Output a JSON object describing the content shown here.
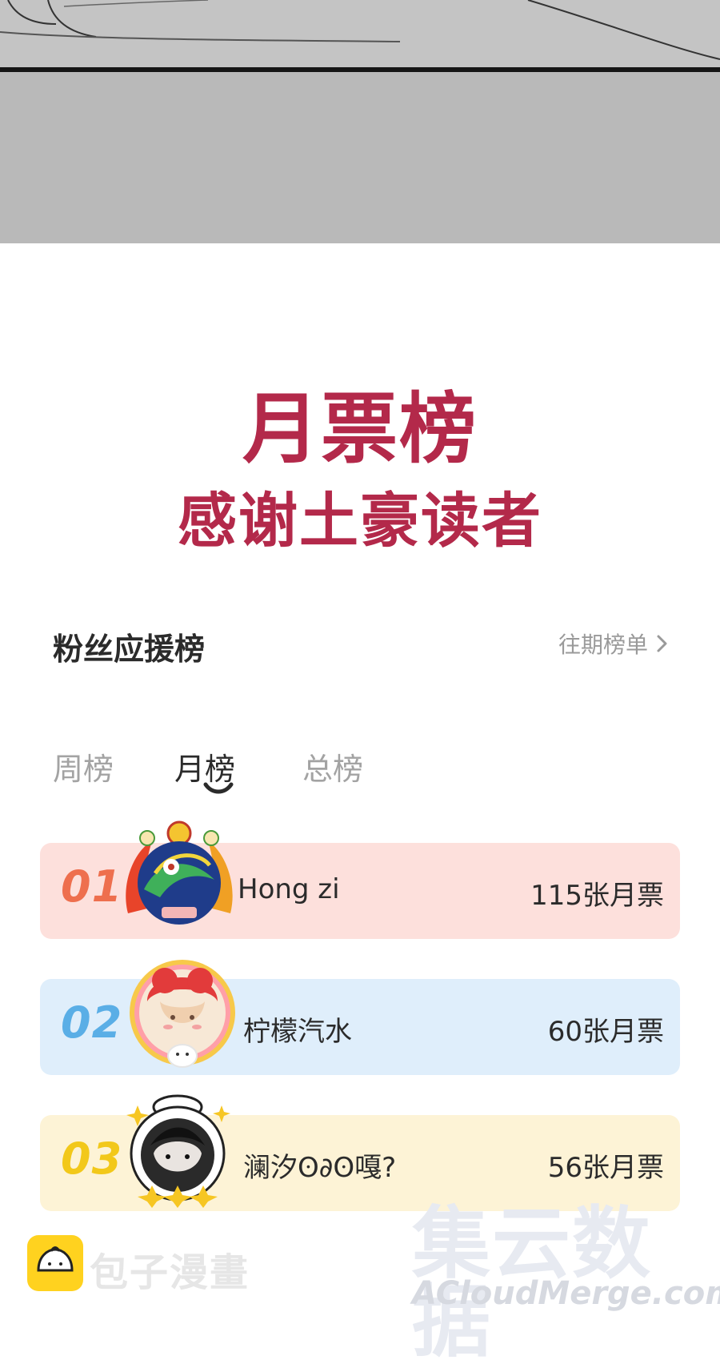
{
  "banner": {
    "title": "月票榜",
    "subtitle": "感谢土豪读者"
  },
  "section": {
    "heading": "粉丝应援榜",
    "history_link": "往期榜单"
  },
  "tabs": [
    {
      "label": "周榜",
      "active": false
    },
    {
      "label": "月榜",
      "active": true
    },
    {
      "label": "总榜",
      "active": false
    }
  ],
  "ranking": [
    {
      "rank": "01",
      "name": "Hong zi",
      "votes": "115张月票",
      "bg": "#fde0dc",
      "num_color": "#ee6f4e",
      "avatar": "dragon-badge-avatar"
    },
    {
      "rank": "02",
      "name": "柠檬汽水",
      "votes": "60张月票",
      "bg": "#dfeefb",
      "num_color": "#5aaee6",
      "avatar": "girl-portrait-avatar"
    },
    {
      "rank": "03",
      "name": "澜汐ʘ∂ʘ嘎?",
      "votes": "56张月票",
      "bg": "#fdf3d6",
      "num_color": "#f2c81a",
      "avatar": "duck-frame-avatar"
    }
  ],
  "footer": {
    "brand_name": "包子漫畫"
  },
  "watermark": {
    "cn": "集云数据",
    "en": "ACloudMerge.com"
  }
}
